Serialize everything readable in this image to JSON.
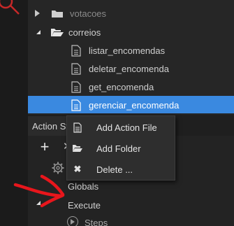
{
  "tree": {
    "rows": [
      {
        "label": "votacoes",
        "icon": "folder-icon",
        "state": "collapsed"
      },
      {
        "label": "correios",
        "icon": "folder-open-icon",
        "state": "expanded"
      },
      {
        "label": "listar_encomendas",
        "icon": "file-icon"
      },
      {
        "label": "deletar_encomenda",
        "icon": "file-icon"
      },
      {
        "label": "get_encomenda",
        "icon": "file-icon"
      },
      {
        "label": "gerenciar_encomenda",
        "icon": "file-icon",
        "selected": true
      }
    ]
  },
  "action_panel": {
    "header": "Action St",
    "toolbar": {
      "add_icon": "plus-icon",
      "close_icon": "x-icon"
    },
    "items": [
      {
        "label": "Globals",
        "state": "collapsed"
      },
      {
        "label": "Execute",
        "state": "expanded"
      },
      {
        "label": "Steps",
        "icon": "play-circle-icon"
      }
    ]
  },
  "context_menu": {
    "items": [
      {
        "label": "Add Action File",
        "icon": "file-icon"
      },
      {
        "label": "Add Folder",
        "icon": "folder-open-icon"
      },
      {
        "label": "Delete ...",
        "icon": "x-icon"
      }
    ]
  },
  "colors": {
    "selection": "#3a89e0",
    "background": "#262626",
    "annotation": "#e8161c"
  }
}
